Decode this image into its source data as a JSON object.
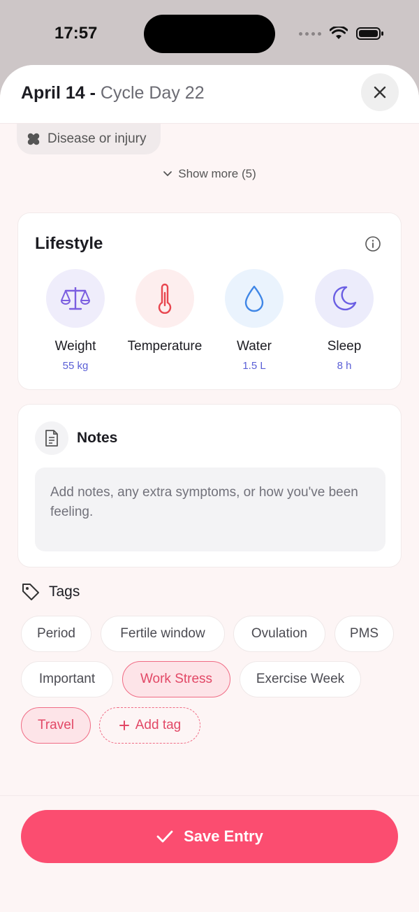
{
  "status": {
    "time": "17:57"
  },
  "header": {
    "date": "April 14",
    "separator": " - ",
    "cycle": "Cycle Day 22"
  },
  "symptoms": {
    "chip": "Disease or injury",
    "show_more": "Show more (5)"
  },
  "lifestyle": {
    "title": "Lifestyle",
    "items": [
      {
        "label": "Weight",
        "value": "55 kg",
        "icon": "scale-icon"
      },
      {
        "label": "Temperature",
        "value": "",
        "icon": "thermometer-icon"
      },
      {
        "label": "Water",
        "value": "1.5 L",
        "icon": "water-drop-icon"
      },
      {
        "label": "Sleep",
        "value": "8 h",
        "icon": "moon-icon"
      }
    ]
  },
  "notes": {
    "title": "Notes",
    "placeholder": "Add notes, any extra symptoms, or how you've been feeling."
  },
  "tags": {
    "title": "Tags",
    "items": [
      {
        "label": "Period",
        "selected": false
      },
      {
        "label": "Fertile window",
        "selected": false
      },
      {
        "label": "Ovulation",
        "selected": false
      },
      {
        "label": "PMS",
        "selected": false
      },
      {
        "label": "Important",
        "selected": false
      },
      {
        "label": "Work Stress",
        "selected": true
      },
      {
        "label": "Exercise Week",
        "selected": false
      },
      {
        "label": "Travel",
        "selected": true
      }
    ],
    "add_label": "Add tag"
  },
  "footer": {
    "save_label": "Save Entry"
  },
  "colors": {
    "accent": "#fb4d70",
    "value_text": "#5a5fd6",
    "selected_tag_bg": "#fde4e8"
  }
}
